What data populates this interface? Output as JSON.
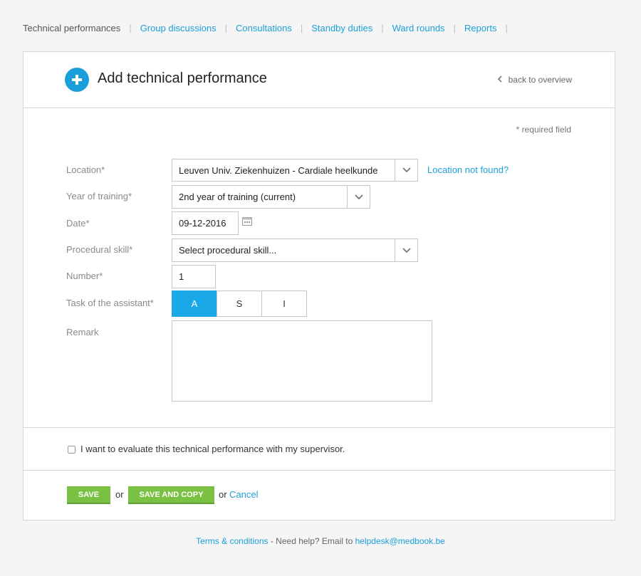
{
  "nav": {
    "items": [
      {
        "label": "Technical performances",
        "active": true
      },
      {
        "label": "Group discussions",
        "active": false
      },
      {
        "label": "Consultations",
        "active": false
      },
      {
        "label": "Standby duties",
        "active": false
      },
      {
        "label": "Ward rounds",
        "active": false
      },
      {
        "label": "Reports",
        "active": false
      }
    ]
  },
  "header": {
    "title": "Add technical performance",
    "back_label": "back to overview",
    "icon": "plus-circle-icon"
  },
  "form": {
    "required_note": "* required field",
    "location": {
      "label": "Location",
      "value": "Leuven Univ. Ziekenhuizen - Cardiale heelkunde",
      "not_found_link": "Location not found?"
    },
    "year": {
      "label": "Year of training",
      "value": "2nd year of training (current)"
    },
    "date": {
      "label": "Date",
      "value": "09-12-2016"
    },
    "skill": {
      "label": "Procedural skill",
      "value": "Select procedural skill..."
    },
    "number": {
      "label": "Number",
      "value": "1"
    },
    "task": {
      "label": "Task of the assistant",
      "options": [
        "A",
        "S",
        "I"
      ],
      "selected": "A"
    },
    "remark": {
      "label": "Remark",
      "value": ""
    },
    "star": "*"
  },
  "evaluate": {
    "label": "I want to evaluate this technical performance with my supervisor.",
    "checked": false
  },
  "actions": {
    "save": "SAVE",
    "or1": "or",
    "save_copy": "SAVE AND COPY",
    "or2": "or",
    "cancel": "Cancel"
  },
  "footer": {
    "terms": "Terms & conditions",
    "help_text": " - Need help? Email to ",
    "email": "helpdesk@medbook.be"
  },
  "colors": {
    "accent": "#1a9fd9",
    "button_green": "#7ac143",
    "selected_segment": "#1aa8e8"
  }
}
